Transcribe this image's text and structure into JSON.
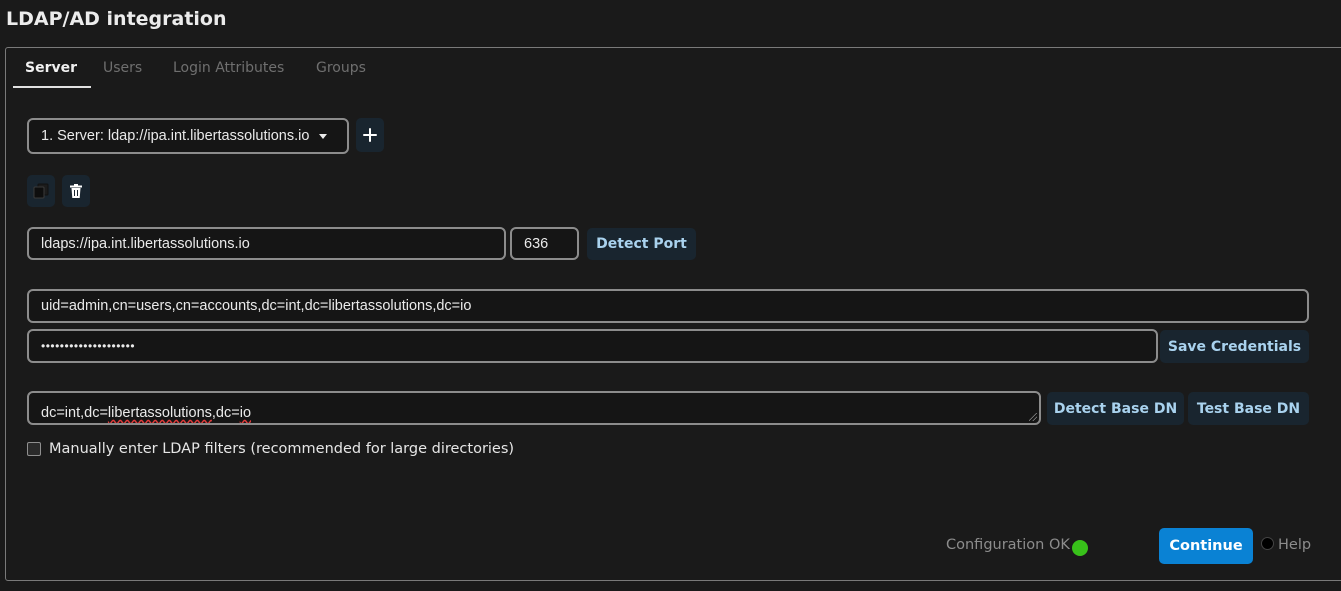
{
  "page": {
    "title": "LDAP/AD integration"
  },
  "tabs": [
    {
      "label": "Server",
      "active": true
    },
    {
      "label": "Users",
      "active": false
    },
    {
      "label": "Login Attributes",
      "active": false
    },
    {
      "label": "Groups",
      "active": false
    }
  ],
  "server": {
    "selected_server": "1. Server: ldap://ipa.int.libertassolutions.io",
    "add_icon": "plus-icon",
    "copy_icon": "copy-icon",
    "delete_icon": "trash-icon"
  },
  "connection": {
    "host": "ldaps://ipa.int.libertassolutions.io",
    "port": "636",
    "detect_port_label": "Detect Port"
  },
  "credentials": {
    "bind_dn": "uid=admin,cn=users,cn=accounts,dc=int,dc=libertassolutions,dc=io",
    "password_masked": "••••••••••••••••••••",
    "save_label": "Save Credentials"
  },
  "base_dn": {
    "prefix": "dc=int,dc=",
    "underlined_1": "libertassolutions",
    "middle": ",dc=",
    "underlined_2": "io",
    "detect_label": "Detect Base DN",
    "test_label": "Test Base DN"
  },
  "filters": {
    "checkbox_label": "Manually enter LDAP filters (recommended for large directories)",
    "checked": false
  },
  "footer": {
    "status_text": "Configuration OK",
    "status_color": "#38c11a",
    "continue_label": "Continue",
    "help_label": "Help"
  },
  "colors": {
    "accent": "#0a82d4",
    "secondary_button_bg": "#19252f",
    "secondary_button_text": "#a9d2ee"
  }
}
